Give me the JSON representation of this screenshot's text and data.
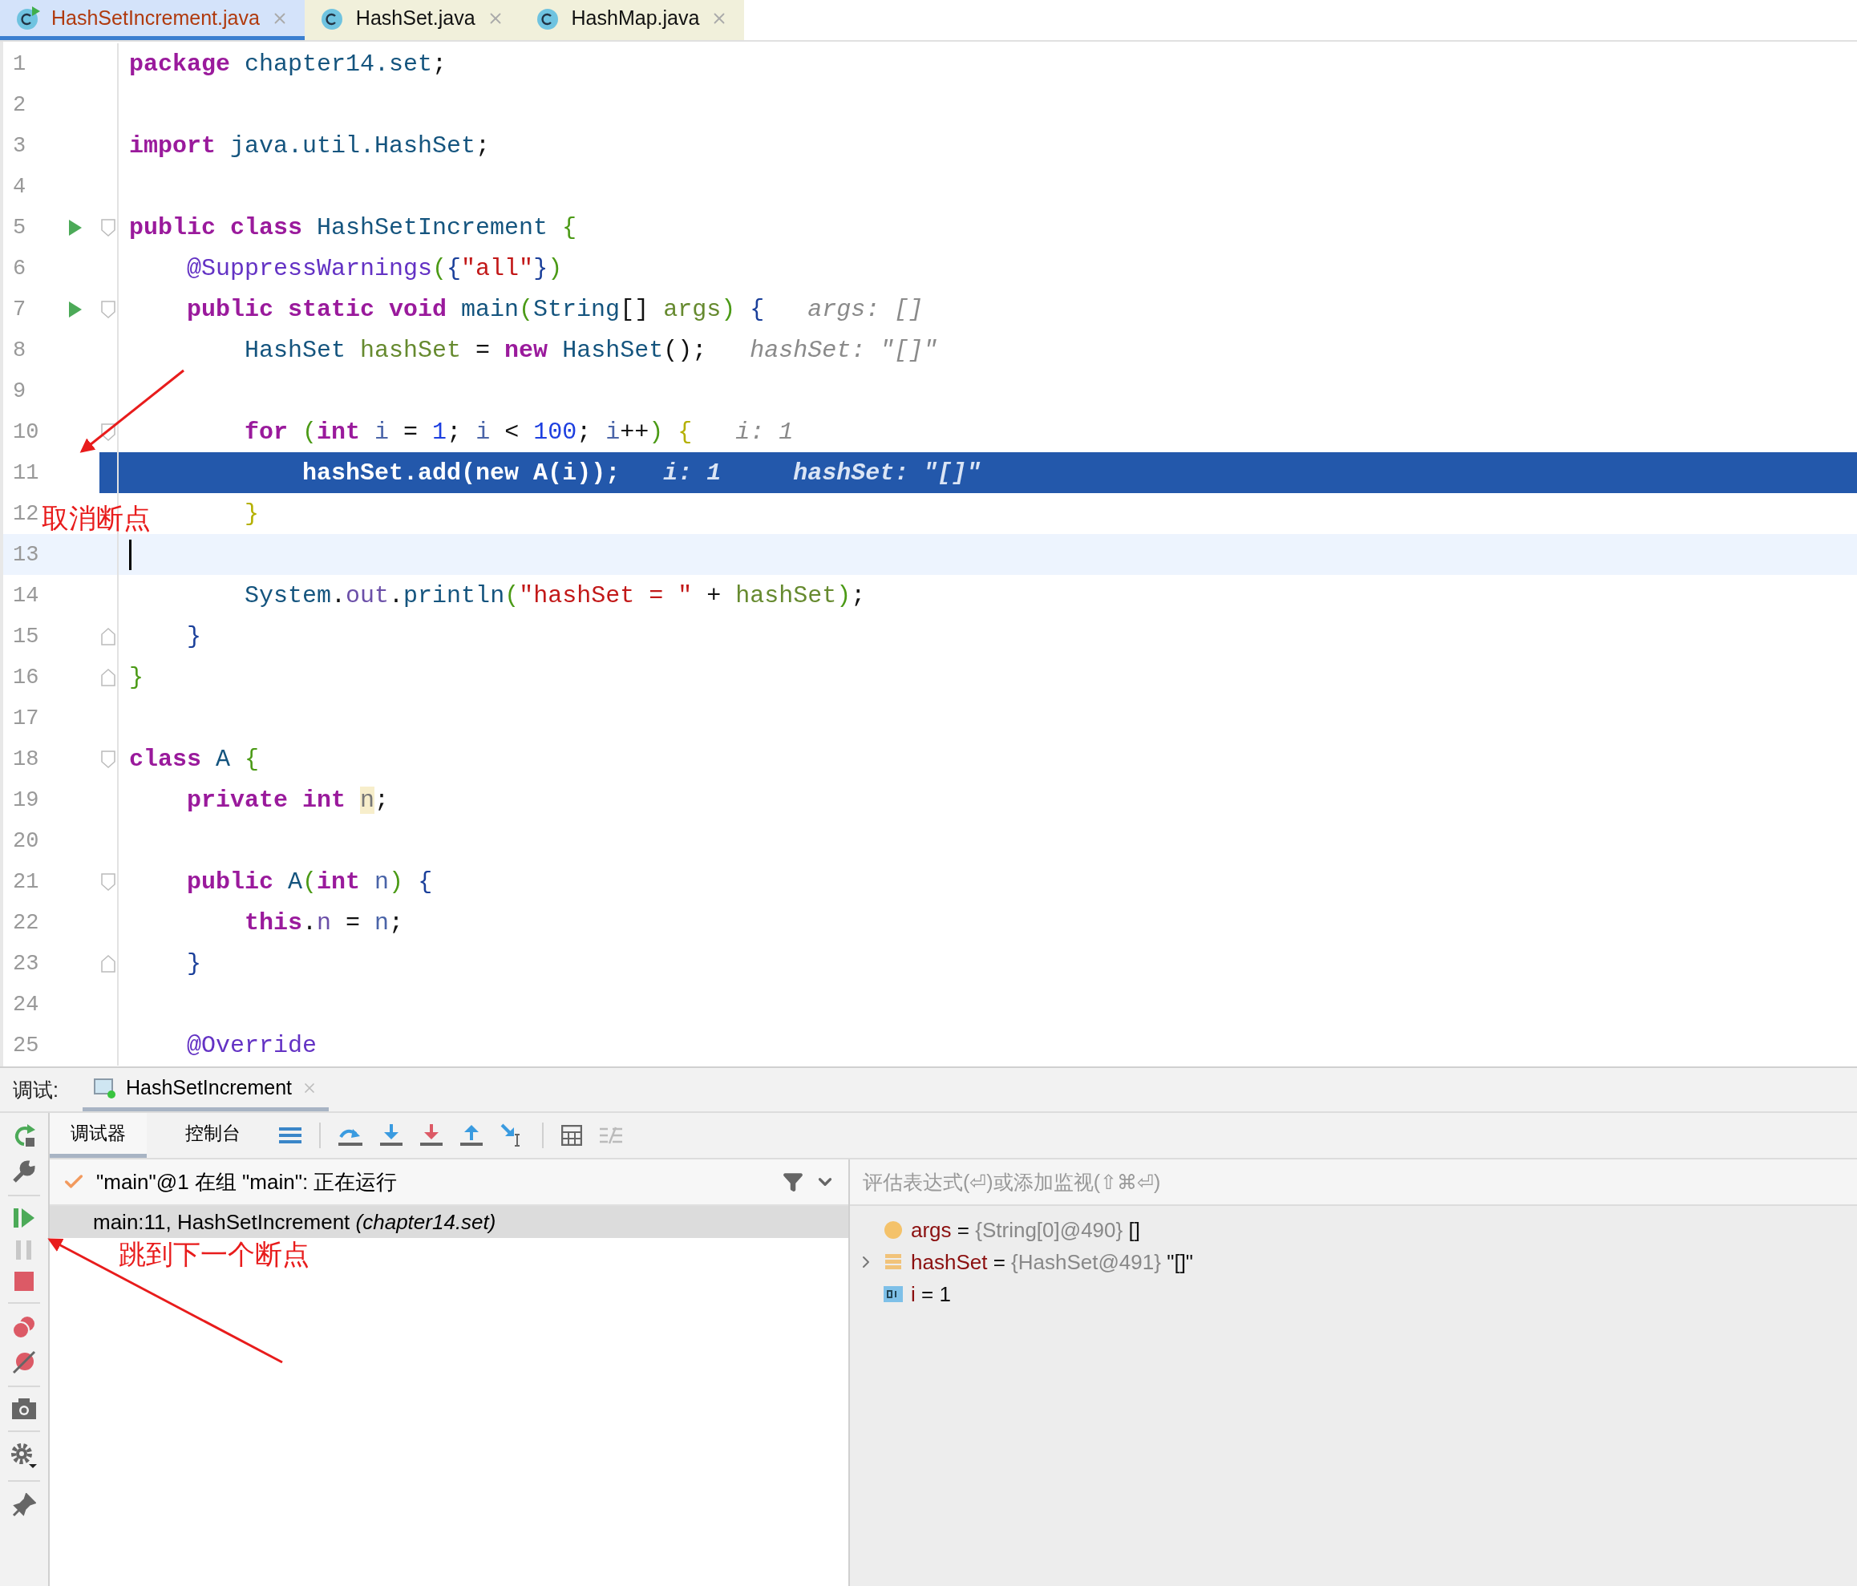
{
  "tabs": [
    {
      "label": "HashSetIncrement.java",
      "selected": true,
      "runnable": true
    },
    {
      "label": "HashSet.java",
      "selected": false,
      "runnable": false
    },
    {
      "label": "HashMap.java",
      "selected": false,
      "runnable": false
    }
  ],
  "editor": {
    "lines": [
      {
        "number": "1",
        "kind": "normal",
        "tokens": [
          {
            "text": "package",
            "kind": "kw"
          },
          {
            "text": " chapter14.set",
            "kind": "cls"
          },
          {
            "text": ";",
            "kind": "p"
          }
        ]
      },
      {
        "number": "2",
        "kind": "normal"
      },
      {
        "number": "3",
        "kind": "normal",
        "tokens": [
          {
            "text": "import",
            "kind": "kw"
          },
          {
            "text": " java.util.HashSet",
            "kind": "cls"
          },
          {
            "text": ";",
            "kind": "p"
          }
        ]
      },
      {
        "number": "4",
        "kind": "normal"
      },
      {
        "number": "5",
        "kind": "normal",
        "gutter": [
          {
            "kind": "run"
          },
          {
            "kind": "fold-start"
          }
        ],
        "tokens": [
          {
            "text": "public class",
            "kind": "kw"
          },
          {
            "text": " HashSetIncrement",
            "kind": "cls"
          },
          {
            "text": " {",
            "kind": "b1"
          }
        ]
      },
      {
        "number": "6",
        "kind": "normal",
        "tokens": [
          {
            "text": "    @SuppressWarnings",
            "kind": "ann"
          },
          {
            "text": "(",
            "kind": "b1"
          },
          {
            "text": "{",
            "kind": "b2"
          },
          {
            "text": "\"all\"",
            "kind": "str"
          },
          {
            "text": "}",
            "kind": "b2"
          },
          {
            "text": ")",
            "kind": "b1"
          }
        ]
      },
      {
        "number": "7",
        "kind": "normal",
        "gutter": [
          {
            "kind": "run"
          },
          {
            "kind": "fold-start"
          }
        ],
        "tokens": [
          {
            "text": "    public static void",
            "kind": "kw"
          },
          {
            "text": " main",
            "kind": "fn"
          },
          {
            "text": "(",
            "kind": "b1"
          },
          {
            "text": "String",
            "kind": "cls"
          },
          {
            "text": "[] ",
            "kind": "p"
          },
          {
            "text": "args",
            "kind": "var"
          },
          {
            "text": ")",
            "kind": "b1"
          },
          {
            "text": " {",
            "kind": "b2"
          },
          {
            "text": "   args: []",
            "kind": "hint"
          }
        ]
      },
      {
        "number": "8",
        "kind": "normal",
        "tokens": [
          {
            "text": "        HashSet",
            "kind": "cls"
          },
          {
            "text": " hashSet",
            "kind": "var"
          },
          {
            "text": " = ",
            "kind": "p"
          },
          {
            "text": "new",
            "kind": "kw"
          },
          {
            "text": " HashSet",
            "kind": "fn"
          },
          {
            "text": "();",
            "kind": "p"
          },
          {
            "text": "   hashSet: \"[]\"",
            "kind": "hint"
          }
        ]
      },
      {
        "number": "9",
        "kind": "normal"
      },
      {
        "number": "10",
        "kind": "normal",
        "gutter": [
          {
            "kind": "fold-start"
          }
        ],
        "tokens": [
          {
            "text": "        for",
            "kind": "kw"
          },
          {
            "text": " (",
            "kind": "b1"
          },
          {
            "text": "int",
            "kind": "kw"
          },
          {
            "text": " i",
            "kind": "lv"
          },
          {
            "text": " = ",
            "kind": "p"
          },
          {
            "text": "1",
            "kind": "num"
          },
          {
            "text": "; ",
            "kind": "p"
          },
          {
            "text": "i",
            "kind": "lv"
          },
          {
            "text": " < ",
            "kind": "p"
          },
          {
            "text": "100",
            "kind": "num"
          },
          {
            "text": "; ",
            "kind": "p"
          },
          {
            "text": "i",
            "kind": "lv"
          },
          {
            "text": "++",
            "kind": "p"
          },
          {
            "text": ")",
            "kind": "b1"
          },
          {
            "text": " {",
            "kind": "b3"
          },
          {
            "text": "   i: 1",
            "kind": "hint"
          }
        ]
      },
      {
        "number": "11",
        "kind": "execution",
        "tokens": [
          {
            "text": "            hashSet",
            "kind": "var"
          },
          {
            "text": ".add(",
            "kind": "p"
          },
          {
            "text": "new",
            "kind": "kw"
          },
          {
            "text": " A(",
            "kind": "p"
          },
          {
            "text": "i",
            "kind": "lv"
          },
          {
            "text": "));",
            "kind": "p"
          },
          {
            "text": "   i: 1",
            "kind": "hint"
          },
          {
            "text": "     hashSet: \"[]\"",
            "kind": "hint"
          }
        ]
      },
      {
        "number": "12",
        "kind": "normal",
        "tokens": [
          {
            "text": "        }",
            "kind": "b3"
          }
        ]
      },
      {
        "number": "13",
        "kind": "caret"
      },
      {
        "number": "14",
        "kind": "normal",
        "tokens": [
          {
            "text": "        System",
            "kind": "cls"
          },
          {
            "text": ".",
            "kind": "p"
          },
          {
            "text": "out",
            "kind": "field"
          },
          {
            "text": ".",
            "kind": "p"
          },
          {
            "text": "println",
            "kind": "fn"
          },
          {
            "text": "(",
            "kind": "b1"
          },
          {
            "text": "\"hashSet = \"",
            "kind": "str"
          },
          {
            "text": " + ",
            "kind": "p"
          },
          {
            "text": "hashSet",
            "kind": "var"
          },
          {
            "text": ")",
            "kind": "b1"
          },
          {
            "text": ";",
            "kind": "p"
          }
        ]
      },
      {
        "number": "15",
        "kind": "normal",
        "gutter": [
          {
            "kind": "fold-end"
          }
        ],
        "tokens": [
          {
            "text": "    }",
            "kind": "b2"
          }
        ]
      },
      {
        "number": "16",
        "kind": "normal",
        "gutter": [
          {
            "kind": "fold-end"
          }
        ],
        "tokens": [
          {
            "text": "}",
            "kind": "b1"
          }
        ]
      },
      {
        "number": "17",
        "kind": "normal"
      },
      {
        "number": "18",
        "kind": "normal",
        "gutter": [
          {
            "kind": "fold-start"
          }
        ],
        "tokens": [
          {
            "text": "class",
            "kind": "kw"
          },
          {
            "text": " A",
            "kind": "cls"
          },
          {
            "text": " {",
            "kind": "b1"
          }
        ]
      },
      {
        "number": "19",
        "kind": "normal",
        "tokens": [
          {
            "text": "    private",
            "kind": "kw"
          },
          {
            "text": " int ",
            "kind": "kw"
          },
          {
            "text": "n",
            "kind": "mark"
          },
          {
            "text": ";",
            "kind": "p"
          }
        ]
      },
      {
        "number": "20",
        "kind": "normal"
      },
      {
        "number": "21",
        "kind": "normal",
        "gutter": [
          {
            "kind": "fold-start"
          }
        ],
        "tokens": [
          {
            "text": "    public",
            "kind": "kw"
          },
          {
            "text": " A",
            "kind": "fn"
          },
          {
            "text": "(",
            "kind": "b1"
          },
          {
            "text": "int",
            "kind": "kw"
          },
          {
            "text": " n",
            "kind": "param"
          },
          {
            "text": ")",
            "kind": "b1"
          },
          {
            "text": " {",
            "kind": "b2"
          }
        ]
      },
      {
        "number": "22",
        "kind": "normal",
        "tokens": [
          {
            "text": "        this",
            "kind": "kw"
          },
          {
            "text": ".",
            "kind": "p"
          },
          {
            "text": "n",
            "kind": "field"
          },
          {
            "text": " = ",
            "kind": "p"
          },
          {
            "text": "n",
            "kind": "param"
          },
          {
            "text": ";",
            "kind": "p"
          }
        ]
      },
      {
        "number": "23",
        "kind": "normal",
        "gutter": [
          {
            "kind": "fold-end"
          }
        ],
        "tokens": [
          {
            "text": "    }",
            "kind": "b2"
          }
        ]
      },
      {
        "number": "24",
        "kind": "normal"
      },
      {
        "number": "25",
        "kind": "normal",
        "tokens": [
          {
            "text": "    @Override",
            "kind": "ann"
          }
        ]
      }
    ]
  },
  "debug": {
    "title": "调试:",
    "session": "HashSetIncrement",
    "tabs": [
      {
        "label": "调试器",
        "selected": true
      },
      {
        "label": "控制台",
        "selected": false
      }
    ],
    "thread": "\"main\"@1 在组 \"main\": 正在运行",
    "frames": [
      {
        "text": "main:11, HashSetIncrement *(chapter14.set)*",
        "selected": true
      }
    ],
    "watch_placeholder": "评估表达式(⏎)或添加监视(⇧⌘⏎)",
    "variables": [
      {
        "kind": "param",
        "name": "args",
        "op": "=",
        "ref": "{String[0]@490}",
        "value": "[]",
        "expandable": false
      },
      {
        "kind": "object",
        "name": "hashSet",
        "op": "=",
        "ref": "{HashSet@491}",
        "value": "\"[]\"",
        "expandable": true
      },
      {
        "kind": "primitive",
        "name": "i",
        "op": "=",
        "value": "1",
        "expandable": false
      }
    ]
  },
  "annotations": [
    {
      "kind": "arrow",
      "text": "取消断点"
    },
    {
      "kind": "arrow",
      "text": "跳到下一个断点"
    }
  ]
}
